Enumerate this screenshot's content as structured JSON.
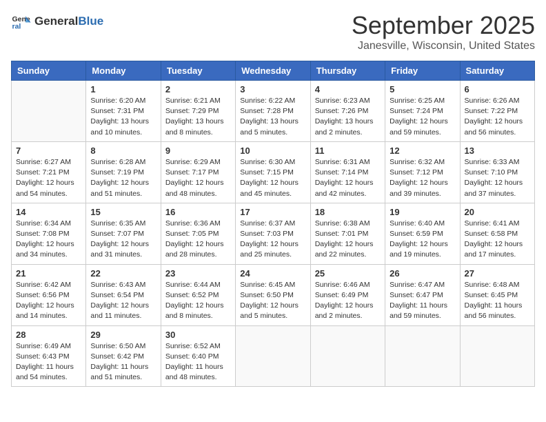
{
  "logo": {
    "general": "General",
    "blue": "Blue"
  },
  "title": "September 2025",
  "location": "Janesville, Wisconsin, United States",
  "days_of_week": [
    "Sunday",
    "Monday",
    "Tuesday",
    "Wednesday",
    "Thursday",
    "Friday",
    "Saturday"
  ],
  "weeks": [
    [
      {
        "day": "",
        "info": ""
      },
      {
        "day": "1",
        "info": "Sunrise: 6:20 AM\nSunset: 7:31 PM\nDaylight: 13 hours\nand 10 minutes."
      },
      {
        "day": "2",
        "info": "Sunrise: 6:21 AM\nSunset: 7:29 PM\nDaylight: 13 hours\nand 8 minutes."
      },
      {
        "day": "3",
        "info": "Sunrise: 6:22 AM\nSunset: 7:28 PM\nDaylight: 13 hours\nand 5 minutes."
      },
      {
        "day": "4",
        "info": "Sunrise: 6:23 AM\nSunset: 7:26 PM\nDaylight: 13 hours\nand 2 minutes."
      },
      {
        "day": "5",
        "info": "Sunrise: 6:25 AM\nSunset: 7:24 PM\nDaylight: 12 hours\nand 59 minutes."
      },
      {
        "day": "6",
        "info": "Sunrise: 6:26 AM\nSunset: 7:22 PM\nDaylight: 12 hours\nand 56 minutes."
      }
    ],
    [
      {
        "day": "7",
        "info": "Sunrise: 6:27 AM\nSunset: 7:21 PM\nDaylight: 12 hours\nand 54 minutes."
      },
      {
        "day": "8",
        "info": "Sunrise: 6:28 AM\nSunset: 7:19 PM\nDaylight: 12 hours\nand 51 minutes."
      },
      {
        "day": "9",
        "info": "Sunrise: 6:29 AM\nSunset: 7:17 PM\nDaylight: 12 hours\nand 48 minutes."
      },
      {
        "day": "10",
        "info": "Sunrise: 6:30 AM\nSunset: 7:15 PM\nDaylight: 12 hours\nand 45 minutes."
      },
      {
        "day": "11",
        "info": "Sunrise: 6:31 AM\nSunset: 7:14 PM\nDaylight: 12 hours\nand 42 minutes."
      },
      {
        "day": "12",
        "info": "Sunrise: 6:32 AM\nSunset: 7:12 PM\nDaylight: 12 hours\nand 39 minutes."
      },
      {
        "day": "13",
        "info": "Sunrise: 6:33 AM\nSunset: 7:10 PM\nDaylight: 12 hours\nand 37 minutes."
      }
    ],
    [
      {
        "day": "14",
        "info": "Sunrise: 6:34 AM\nSunset: 7:08 PM\nDaylight: 12 hours\nand 34 minutes."
      },
      {
        "day": "15",
        "info": "Sunrise: 6:35 AM\nSunset: 7:07 PM\nDaylight: 12 hours\nand 31 minutes."
      },
      {
        "day": "16",
        "info": "Sunrise: 6:36 AM\nSunset: 7:05 PM\nDaylight: 12 hours\nand 28 minutes."
      },
      {
        "day": "17",
        "info": "Sunrise: 6:37 AM\nSunset: 7:03 PM\nDaylight: 12 hours\nand 25 minutes."
      },
      {
        "day": "18",
        "info": "Sunrise: 6:38 AM\nSunset: 7:01 PM\nDaylight: 12 hours\nand 22 minutes."
      },
      {
        "day": "19",
        "info": "Sunrise: 6:40 AM\nSunset: 6:59 PM\nDaylight: 12 hours\nand 19 minutes."
      },
      {
        "day": "20",
        "info": "Sunrise: 6:41 AM\nSunset: 6:58 PM\nDaylight: 12 hours\nand 17 minutes."
      }
    ],
    [
      {
        "day": "21",
        "info": "Sunrise: 6:42 AM\nSunset: 6:56 PM\nDaylight: 12 hours\nand 14 minutes."
      },
      {
        "day": "22",
        "info": "Sunrise: 6:43 AM\nSunset: 6:54 PM\nDaylight: 12 hours\nand 11 minutes."
      },
      {
        "day": "23",
        "info": "Sunrise: 6:44 AM\nSunset: 6:52 PM\nDaylight: 12 hours\nand 8 minutes."
      },
      {
        "day": "24",
        "info": "Sunrise: 6:45 AM\nSunset: 6:50 PM\nDaylight: 12 hours\nand 5 minutes."
      },
      {
        "day": "25",
        "info": "Sunrise: 6:46 AM\nSunset: 6:49 PM\nDaylight: 12 hours\nand 2 minutes."
      },
      {
        "day": "26",
        "info": "Sunrise: 6:47 AM\nSunset: 6:47 PM\nDaylight: 11 hours\nand 59 minutes."
      },
      {
        "day": "27",
        "info": "Sunrise: 6:48 AM\nSunset: 6:45 PM\nDaylight: 11 hours\nand 56 minutes."
      }
    ],
    [
      {
        "day": "28",
        "info": "Sunrise: 6:49 AM\nSunset: 6:43 PM\nDaylight: 11 hours\nand 54 minutes."
      },
      {
        "day": "29",
        "info": "Sunrise: 6:50 AM\nSunset: 6:42 PM\nDaylight: 11 hours\nand 51 minutes."
      },
      {
        "day": "30",
        "info": "Sunrise: 6:52 AM\nSunset: 6:40 PM\nDaylight: 11 hours\nand 48 minutes."
      },
      {
        "day": "",
        "info": ""
      },
      {
        "day": "",
        "info": ""
      },
      {
        "day": "",
        "info": ""
      },
      {
        "day": "",
        "info": ""
      }
    ]
  ]
}
